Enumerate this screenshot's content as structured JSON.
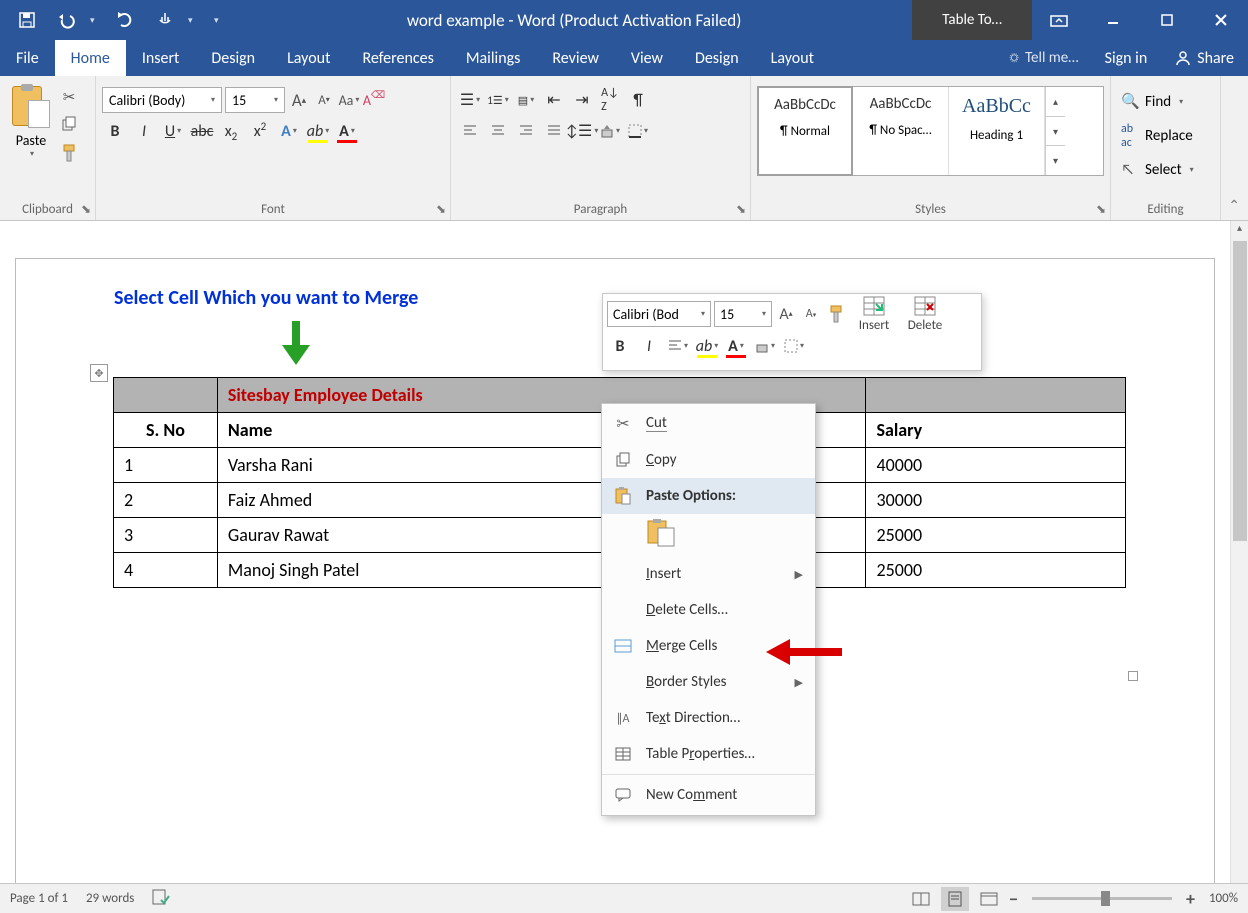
{
  "title": "word example - Word (Product Activation Failed)",
  "table_tools_label": "Table To…",
  "tabs": {
    "file": "File",
    "home": "Home",
    "insert": "Insert",
    "design": "Design",
    "layout": "Layout",
    "references": "References",
    "mailings": "Mailings",
    "review": "Review",
    "view": "View",
    "t_design": "Design",
    "t_layout": "Layout"
  },
  "tell_me": "Tell me…",
  "sign_in": "Sign in",
  "share": "Share",
  "ribbon": {
    "clipboard": {
      "label": "Clipboard",
      "paste": "Paste"
    },
    "font": {
      "label": "Font",
      "family": "Calibri (Body)",
      "size": "15"
    },
    "paragraph": {
      "label": "Paragraph"
    },
    "styles": {
      "label": "Styles",
      "preview": "AaBbCcDc",
      "preview_heading": "AaBbCc",
      "normal": "¶ Normal",
      "nospac": "¶ No Spac…",
      "heading1": "Heading 1"
    },
    "editing": {
      "label": "Editing",
      "find": "Find",
      "replace": "Replace",
      "select": "Select"
    }
  },
  "mini_toolbar": {
    "font": "Calibri (Bod",
    "size": "15",
    "insert": "Insert",
    "delete": "Delete"
  },
  "context_menu": {
    "cut": "Cut",
    "copy": "Copy",
    "paste_options": "Paste Options:",
    "insert": "Insert",
    "delete_cells": "Delete Cells…",
    "merge_cells": "Merge Cells",
    "border_styles": "Border Styles",
    "text_direction": "Text Direction…",
    "table_properties": "Table Properties…",
    "new_comment": "New Comment"
  },
  "callout": "Select Cell Which you want to Merge",
  "table": {
    "title": "Sitesbay Employee Details",
    "headers": {
      "sno": "S. No",
      "name": "Name",
      "salary": "Salary"
    },
    "rows": [
      {
        "sno": "1",
        "name": "Varsha Rani",
        "salary": "40000"
      },
      {
        "sno": "2",
        "name": "Faiz Ahmed",
        "salary": "30000"
      },
      {
        "sno": "3",
        "name": "Gaurav Rawat",
        "salary": "25000"
      },
      {
        "sno": "4",
        "name": "Manoj Singh Patel",
        "salary": "25000"
      }
    ]
  },
  "status": {
    "page": "Page 1 of 1",
    "words": "29 words",
    "zoom": "100%"
  }
}
